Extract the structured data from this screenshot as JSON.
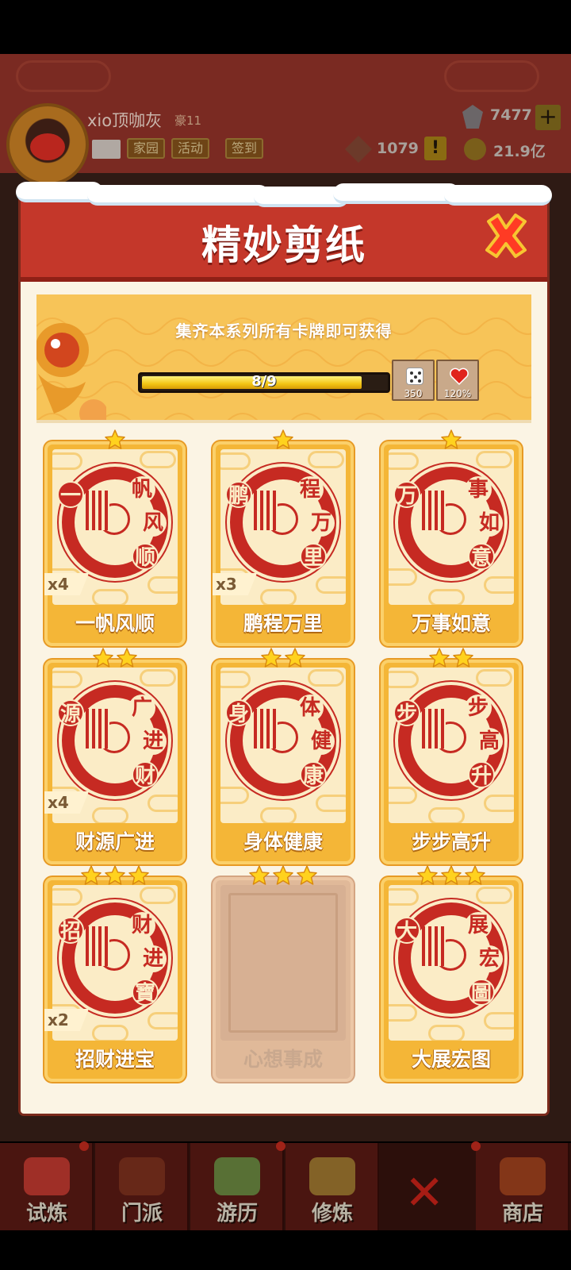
{
  "hud": {
    "player_name": "xio顶咖灰",
    "rank": "豪11",
    "btn_family": "家园",
    "btn_activity": "活动",
    "btn_checkin": "签到",
    "gems": "7477",
    "seals": "1079",
    "coins": "21.9亿"
  },
  "modal": {
    "title": "精妙剪纸",
    "banner_text": "集齐本系列所有卡牌即可获得",
    "progress_text": "8/9",
    "progress_fraction": 0.889,
    "rewards": [
      {
        "icon": "dice-icon",
        "value": "350"
      },
      {
        "icon": "heart-icon",
        "value": "120%"
      }
    ]
  },
  "cards": [
    {
      "label": "一帆风顺",
      "stars": 1,
      "count": "x4",
      "locked": false
    },
    {
      "label": "鹏程万里",
      "stars": 1,
      "count": "x3",
      "locked": false
    },
    {
      "label": "万事如意",
      "stars": 1,
      "count": "",
      "locked": false
    },
    {
      "label": "财源广进",
      "stars": 2,
      "count": "x4",
      "locked": false
    },
    {
      "label": "身体健康",
      "stars": 2,
      "count": "",
      "locked": false
    },
    {
      "label": "步步高升",
      "stars": 2,
      "count": "",
      "locked": false
    },
    {
      "label": "招财进宝",
      "stars": 3,
      "count": "x2",
      "locked": false
    },
    {
      "label": "心想事成",
      "stars": 3,
      "count": "",
      "locked": true
    },
    {
      "label": "大展宏图",
      "stars": 3,
      "count": "",
      "locked": false
    }
  ],
  "card_art": [
    [
      "一",
      "帆",
      "风",
      "顺"
    ],
    [
      "鹏",
      "程",
      "万",
      "里"
    ],
    [
      "万",
      "事",
      "如",
      "意"
    ],
    [
      "源",
      "广",
      "进",
      "财"
    ],
    [
      "身",
      "体",
      "健",
      "康"
    ],
    [
      "步",
      "步",
      "高",
      "升"
    ],
    [
      "招",
      "财",
      "进",
      "寶"
    ],
    [],
    [
      "大",
      "展",
      "宏",
      "圖"
    ]
  ],
  "nav": [
    "试炼",
    "门派",
    "游历",
    "修炼",
    "",
    "商店"
  ],
  "colors": {
    "header_red": "#c4372a",
    "card_gold": "#f4b637",
    "papercut_red": "#c62a22",
    "star_yellow": "#ffd21e"
  }
}
